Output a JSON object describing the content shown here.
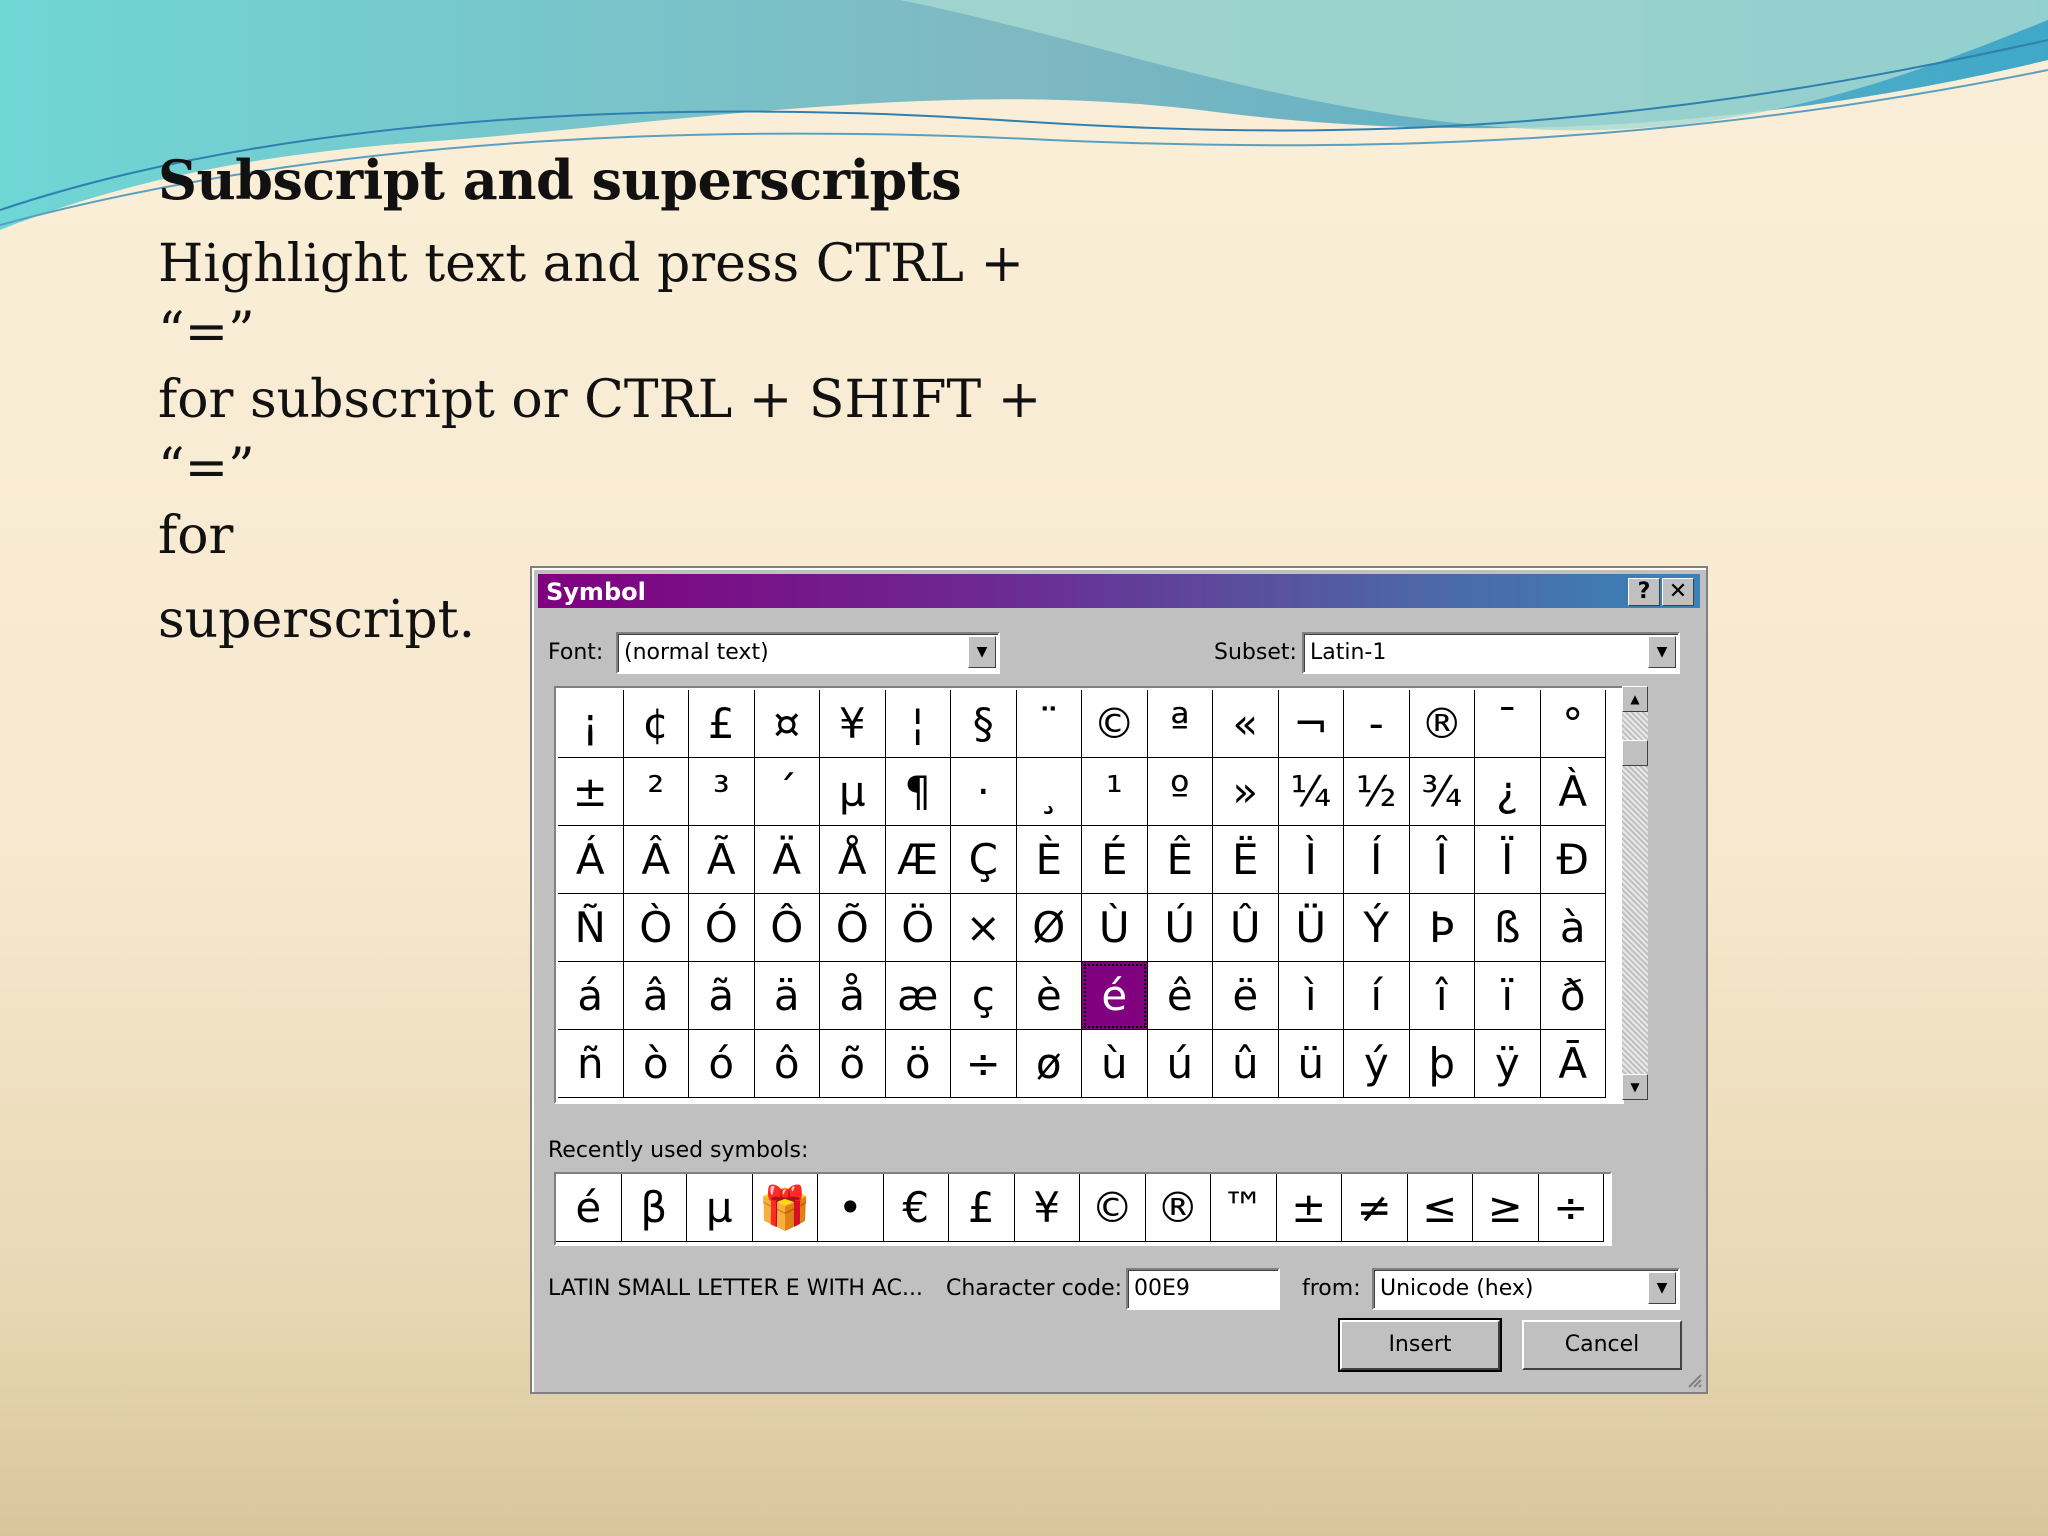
{
  "slide": {
    "title": "Subscript and superscripts",
    "body_line1": "Highlight text and press CTRL + “=”",
    "body_line2": "for subscript or CTRL + SHIFT + “=”",
    "body_line3": "for",
    "body_line4": "superscript."
  },
  "dialog": {
    "title": "Symbol",
    "help_label": "?",
    "close_label": "✕",
    "font_label": "Font:",
    "font_value": "(normal text)",
    "subset_label": "Subset:",
    "subset_value": "Latin-1",
    "symbols": [
      [
        "¡",
        "¢",
        "£",
        "¤",
        "¥",
        "¦",
        "§",
        "¨",
        "©",
        "ª",
        "«",
        "¬",
        "-",
        "®",
        "¯",
        "°"
      ],
      [
        "±",
        "²",
        "³",
        "´",
        "µ",
        "¶",
        "·",
        "¸",
        "¹",
        "º",
        "»",
        "¼",
        "½",
        "¾",
        "¿",
        "À"
      ],
      [
        "Á",
        "Â",
        "Ã",
        "Ä",
        "Å",
        "Æ",
        "Ç",
        "È",
        "É",
        "Ê",
        "Ë",
        "Ì",
        "Í",
        "Î",
        "Ï",
        "Ð"
      ],
      [
        "Ñ",
        "Ò",
        "Ó",
        "Ô",
        "Õ",
        "Ö",
        "×",
        "Ø",
        "Ù",
        "Ú",
        "Û",
        "Ü",
        "Ý",
        "Þ",
        "ß",
        "à"
      ],
      [
        "á",
        "â",
        "ã",
        "ä",
        "å",
        "æ",
        "ç",
        "è",
        "é",
        "ê",
        "ë",
        "ì",
        "í",
        "î",
        "ï",
        "ð"
      ],
      [
        "ñ",
        "ò",
        "ó",
        "ô",
        "õ",
        "ö",
        "÷",
        "ø",
        "ù",
        "ú",
        "û",
        "ü",
        "ý",
        "þ",
        "ÿ",
        "Ā"
      ]
    ],
    "selected_symbol": "é",
    "recent_label": "Recently used symbols:",
    "recent_symbols": [
      "é",
      "β",
      "µ",
      "🎁",
      "•",
      "€",
      "£",
      "¥",
      "©",
      "®",
      "™",
      "±",
      "≠",
      "≤",
      "≥",
      "÷"
    ],
    "char_name": "LATIN SMALL LETTER E WITH AC...",
    "char_code_label": "Character code:",
    "char_code_value": "00E9",
    "from_label": "from:",
    "from_value": "Unicode (hex)",
    "insert_label": "Insert",
    "cancel_label": "Cancel"
  },
  "colors": {
    "selection": "#800080",
    "titlebar_start": "#800080",
    "titlebar_end": "#3a83b8",
    "dialog_face": "#c0c0c0"
  }
}
